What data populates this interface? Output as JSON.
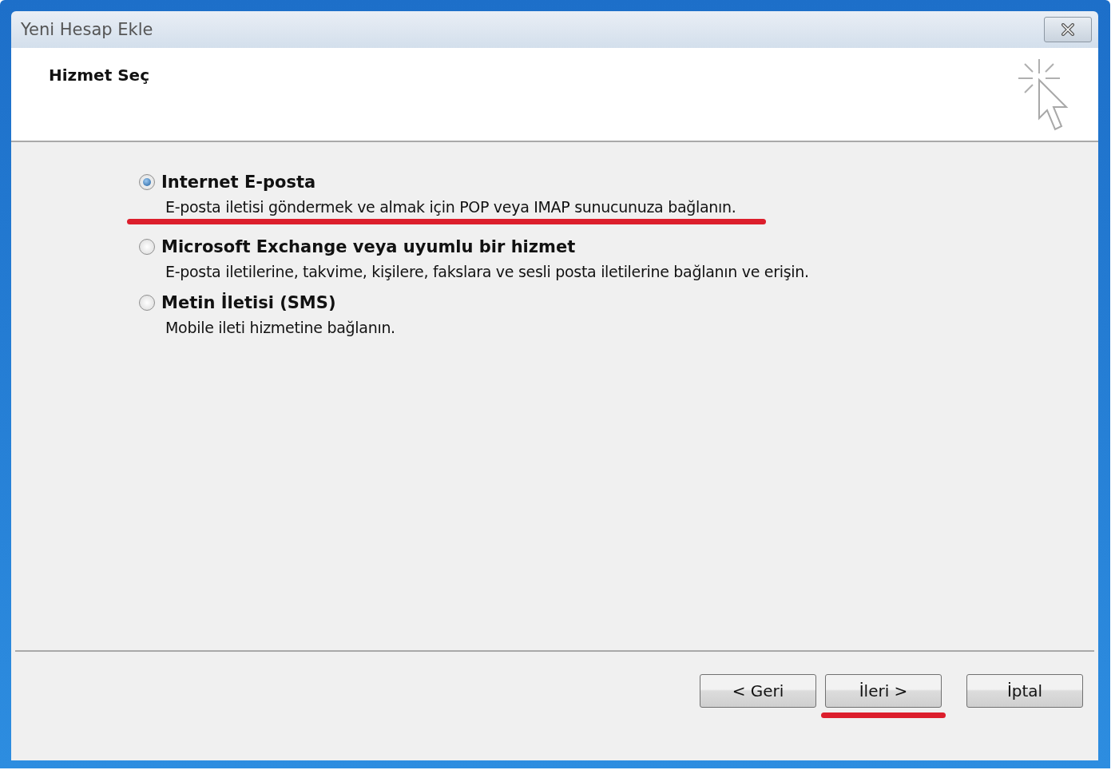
{
  "window": {
    "title": "Yeni Hesap Ekle"
  },
  "header": {
    "title": "Hizmet Seç"
  },
  "options": [
    {
      "label": "Internet E-posta",
      "description": "E-posta iletisi göndermek ve almak için POP veya IMAP sunucunuza bağlanın.",
      "selected": true,
      "highlighted": true
    },
    {
      "label": "Microsoft Exchange veya uyumlu bir hizmet",
      "description": "E-posta iletilerine, takvime, kişilere, fakslara ve sesli posta iletilerine bağlanın ve erişin.",
      "selected": false,
      "highlighted": false
    },
    {
      "label": "Metin İletisi (SMS)",
      "description": "Mobile ileti hizmetine bağlanın.",
      "selected": false,
      "highlighted": false
    }
  ],
  "buttons": [
    {
      "label": "< Geri",
      "highlighted": false
    },
    {
      "label": "İleri >",
      "highlighted": true
    },
    {
      "label": "İptal",
      "highlighted": false
    }
  ]
}
